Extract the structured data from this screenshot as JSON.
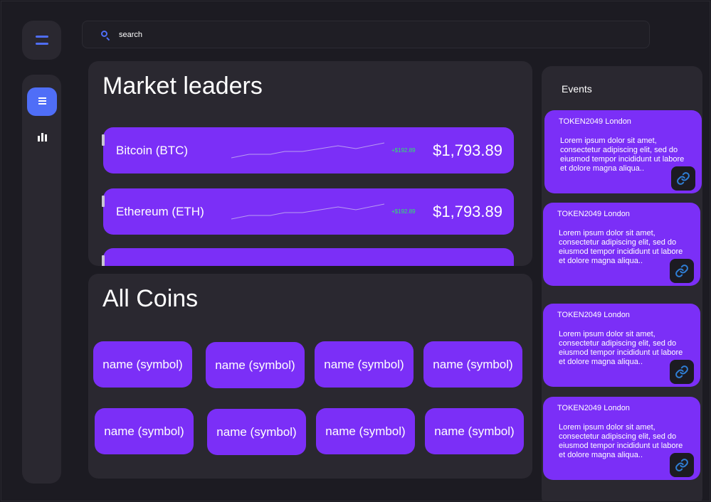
{
  "sidebar": {
    "menu_icon": "menu-icon",
    "items": [
      {
        "name": "dashboard",
        "icon": "document-icon",
        "active": true
      },
      {
        "name": "charts",
        "icon": "bar-chart-icon",
        "active": false
      }
    ]
  },
  "search": {
    "placeholder": "search",
    "value": ""
  },
  "market": {
    "title": "Market leaders",
    "items": [
      {
        "label": "Bitcoin (BTC)",
        "change": "+$192.89",
        "price": "$1,793.89"
      },
      {
        "label": "Ethereum (ETH)",
        "change": "+$192.89",
        "price": "$1,793.89"
      }
    ]
  },
  "coins": {
    "title": "All Coins",
    "items": [
      "name (symbol)",
      "name (symbol)",
      "name (symbol)",
      "name (symbol)",
      "name (symbol)",
      "name (symbol)",
      "name (symbol)",
      "name (symbol)"
    ]
  },
  "events": {
    "title": "Events",
    "items": [
      {
        "title": "TOKEN2049 London",
        "body": "Lorem ipsum dolor sit amet, consectetur adipiscing elit, sed do eiusmod tempor incididunt ut labore et dolore magna aliqua.."
      },
      {
        "title": "TOKEN2049 London",
        "body": "Lorem ipsum dolor sit amet, consectetur adipiscing elit, sed do eiusmod tempor incididunt ut labore et dolore magna aliqua.."
      },
      {
        "title": "TOKEN2049 London",
        "body": "Lorem ipsum dolor sit amet, consectetur adipiscing elit, sed do eiusmod tempor incididunt ut labore et dolore magna aliqua.."
      },
      {
        "title": "TOKEN2049 London",
        "body": "Lorem ipsum dolor sit amet, consectetur adipiscing elit, sed do eiusmod tempor incididunt ut labore et dolore magna aliqua.."
      }
    ]
  },
  "colors": {
    "background": "#1c1b22",
    "panel": "#2a2830",
    "card": "#7b2ff7",
    "accent": "#4f6ef7",
    "positive": "#2ee86a",
    "link_icon": "#2f7fd6"
  }
}
